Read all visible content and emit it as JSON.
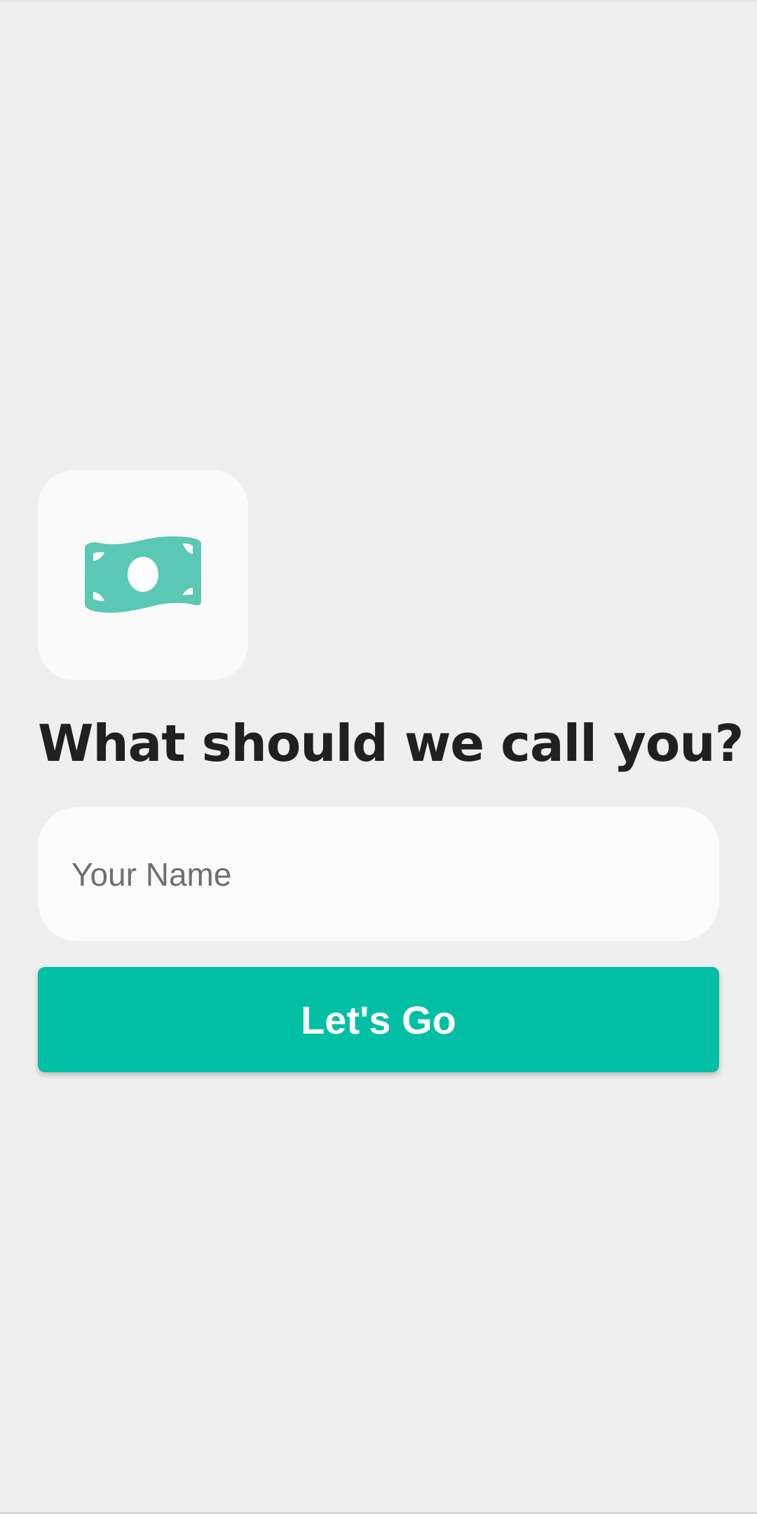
{
  "screen": {
    "background_color": "#efefef"
  },
  "app_icon": {
    "name": "money-bill-icon",
    "color": "#5ac8b4",
    "tile_color": "#fafafa"
  },
  "onboarding": {
    "heading": "What should we call you?",
    "name_input": {
      "placeholder": "Your Name",
      "value": ""
    },
    "submit_button": {
      "label": "Let's Go",
      "color": "#00bfa5"
    }
  }
}
